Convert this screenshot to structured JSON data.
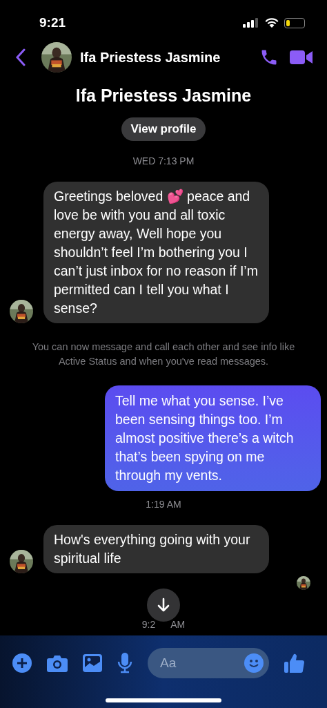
{
  "status_bar": {
    "time": "9:21"
  },
  "header": {
    "name": "Ifa Priestess Jasmine"
  },
  "profile": {
    "name": "Ifa Priestess Jasmine",
    "button": "View profile"
  },
  "messages": [
    {
      "kind": "timestamp",
      "text": "WED 7:13 PM"
    },
    {
      "kind": "incoming",
      "text": "Greetings beloved 💕 peace and love be with you and all toxic energy away, Well hope you shouldn’t feel I’m bothering you I can’t just inbox for no reason if I’m permitted can I tell you what I sense?"
    },
    {
      "kind": "notice",
      "text": "You can now message and call each other and see info like Active Status and when you've read messages."
    },
    {
      "kind": "outgoing",
      "text": "Tell me what you sense. I’ve been sensing things too. I’m almost positive there’s a witch that’s been spying on me through my vents."
    },
    {
      "kind": "timestamp",
      "text": "1:19 AM"
    },
    {
      "kind": "incoming",
      "text": "How's everything going with your spiritual life"
    }
  ],
  "last_time": {
    "before": "9:2",
    "after": "AM"
  },
  "composer": {
    "placeholder": "Aa"
  }
}
